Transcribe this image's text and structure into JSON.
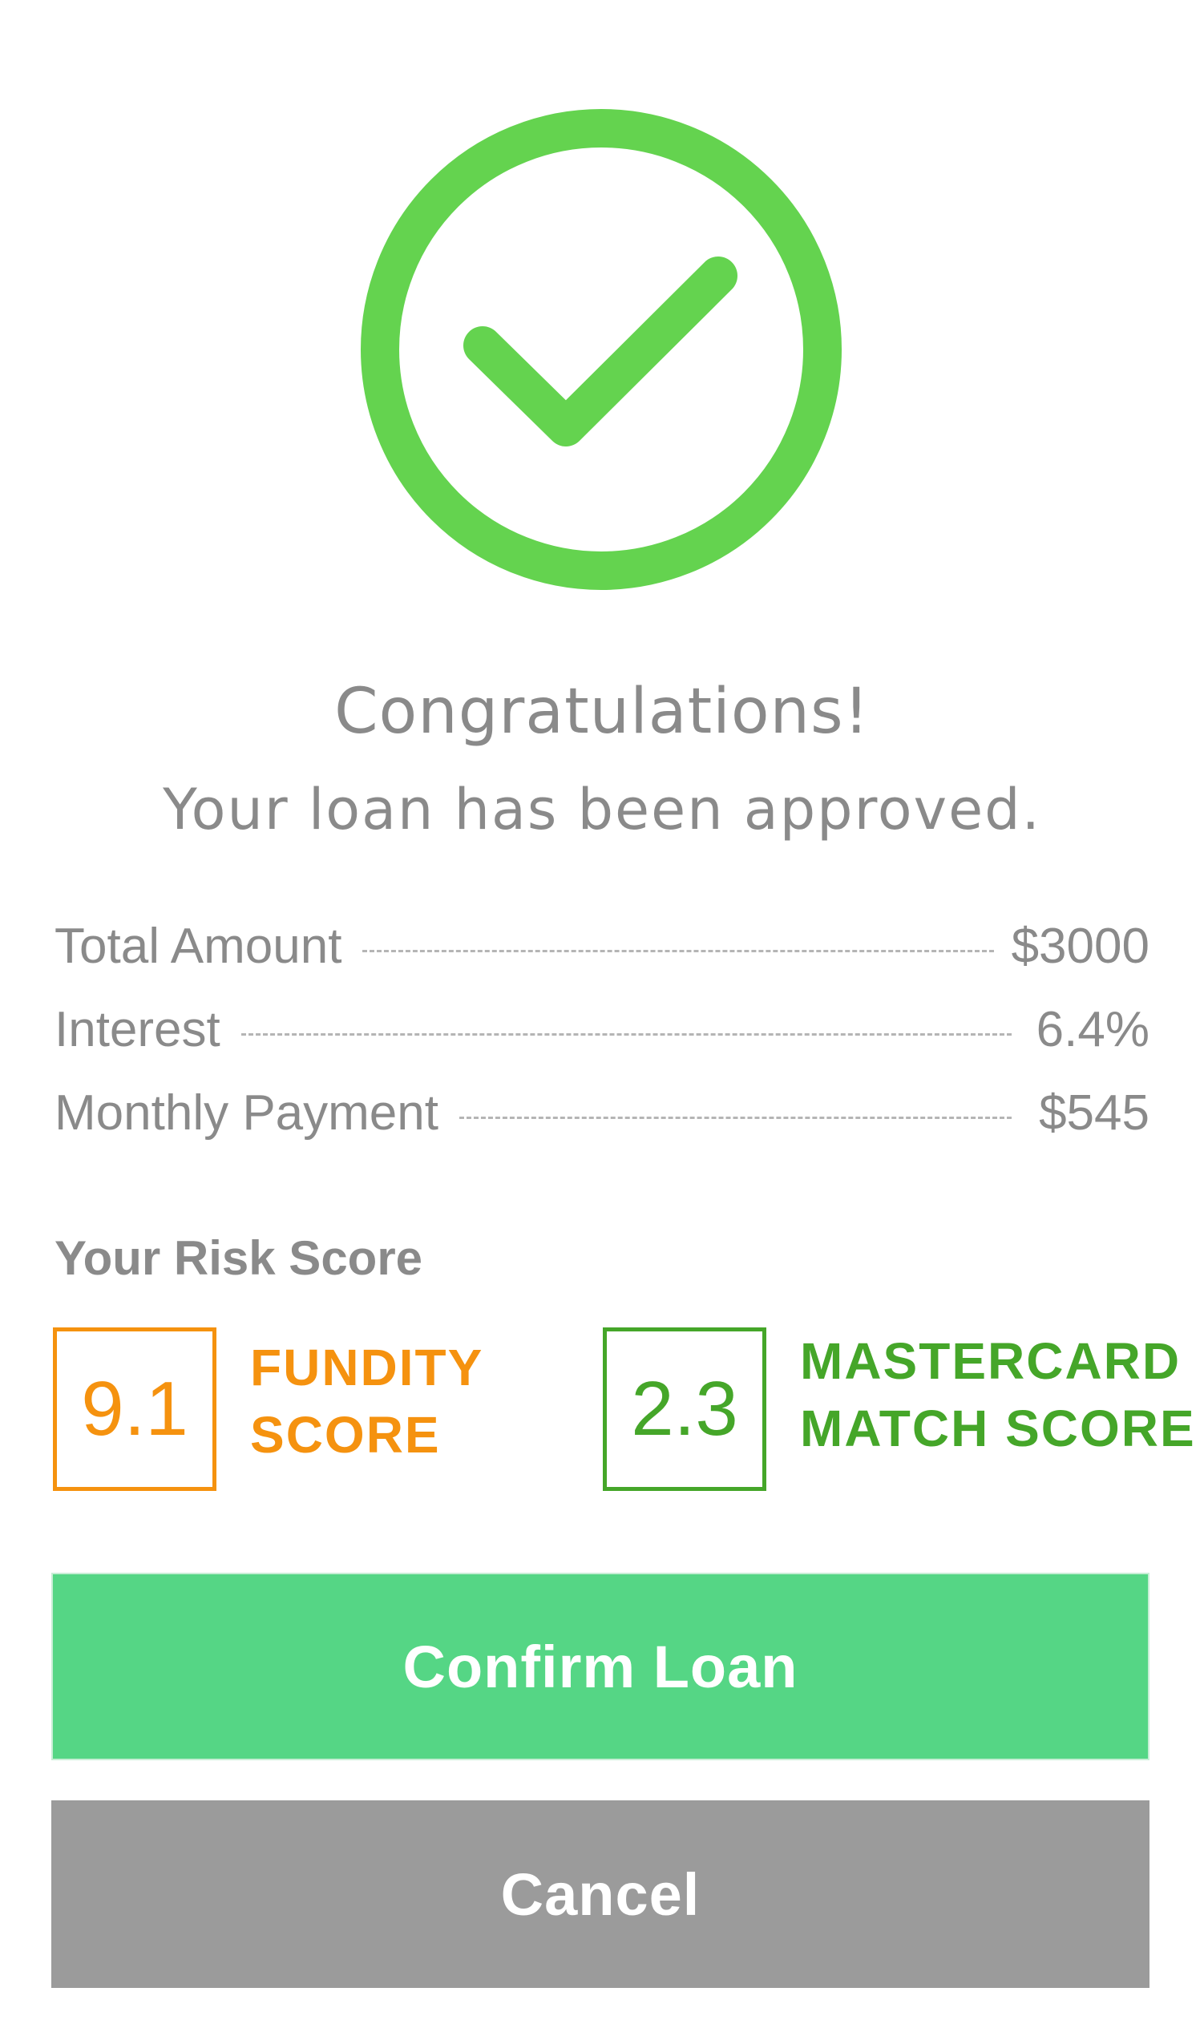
{
  "colors": {
    "check_green": "#64d34f",
    "text_gray": "#8a8a8a",
    "fundity_orange": "#f5920f",
    "mastercard_green": "#45a629",
    "confirm_button": "#55d685",
    "cancel_button": "#9b9b9b"
  },
  "status": {
    "icon": "check-circle-icon",
    "headline": "Congratulations!",
    "message": "Your loan has been approved."
  },
  "loan_details": [
    {
      "label": "Total Amount",
      "value": "$3000"
    },
    {
      "label": "Interest",
      "value": "6.4%"
    },
    {
      "label": "Monthly Payment",
      "value": "$545"
    }
  ],
  "risk": {
    "title": "Your Risk Score",
    "fundity": {
      "score": "9.1",
      "label_line1": "FUNDITY",
      "label_line2": "SCORE"
    },
    "mastercard": {
      "score": "2.3",
      "label_line1": "MASTERCARD",
      "label_line2": "MATCH SCORE"
    }
  },
  "actions": {
    "confirm_label": "Confirm Loan",
    "cancel_label": "Cancel"
  }
}
